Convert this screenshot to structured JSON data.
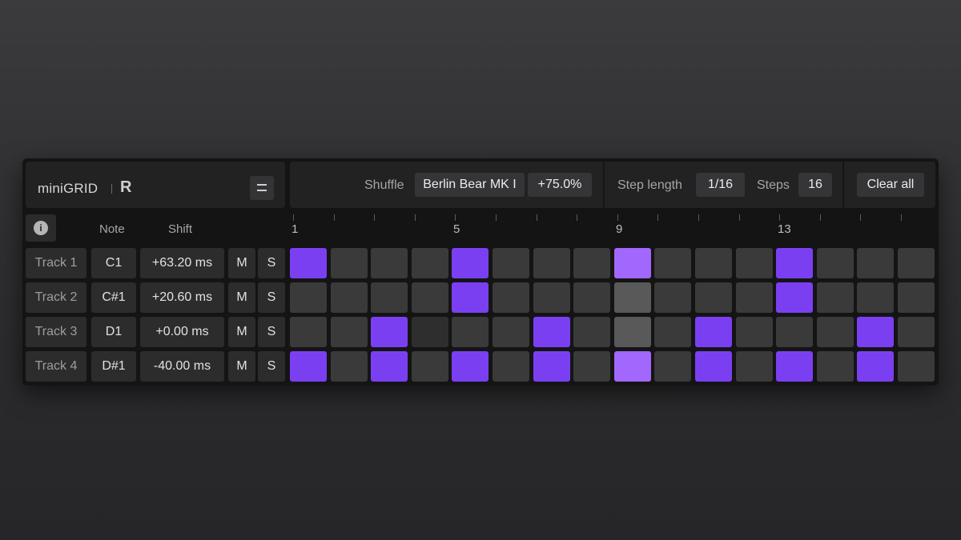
{
  "app": {
    "name": "miniGRID",
    "logo_letter": "R"
  },
  "header": {
    "shuffle_label": "Shuffle",
    "shuffle_preset": "Berlin Bear MK I",
    "shuffle_amount": "+75.0%",
    "step_length_label": "Step length",
    "step_length_value": "1/16",
    "steps_label": "Steps",
    "steps_value": "16",
    "clear_label": "Clear all"
  },
  "columns": {
    "note": "Note",
    "shift": "Shift",
    "info_icon": "info-icon",
    "menu_icon": "hamburger-icon"
  },
  "beat_markers": [
    "1",
    "5",
    "9",
    "13"
  ],
  "colors": {
    "accent": "#7b3ff2",
    "accent_light": "#a267fc",
    "step_off": "#3a3a3b"
  },
  "tracks": [
    {
      "name": "Track 1",
      "note": "C1",
      "shift": "+63.20 ms",
      "mute": "M",
      "solo": "S",
      "steps": [
        "on",
        "off",
        "off",
        "off",
        "on",
        "off",
        "off",
        "off",
        "hi",
        "off",
        "off",
        "off",
        "on",
        "off",
        "off",
        "off"
      ]
    },
    {
      "name": "Track 2",
      "note": "C#1",
      "shift": "+20.60 ms",
      "mute": "M",
      "solo": "S",
      "steps": [
        "off",
        "off",
        "off",
        "off",
        "on",
        "off",
        "off",
        "off",
        "mid",
        "off",
        "off",
        "off",
        "on",
        "off",
        "off",
        "off"
      ]
    },
    {
      "name": "Track 3",
      "note": "D1",
      "shift": "+0.00 ms",
      "mute": "M",
      "solo": "S",
      "steps": [
        "off",
        "off",
        "on",
        "off",
        "off",
        "off",
        "on",
        "off",
        "mid",
        "off",
        "on",
        "off",
        "off",
        "off",
        "on",
        "off"
      ]
    },
    {
      "name": "Track 4",
      "note": "D#1",
      "shift": "-40.00 ms",
      "mute": "M",
      "solo": "S",
      "steps": [
        "on",
        "off",
        "on",
        "off",
        "on",
        "off",
        "on",
        "off",
        "hi",
        "off",
        "on",
        "off",
        "on",
        "off",
        "on",
        "off"
      ]
    }
  ]
}
